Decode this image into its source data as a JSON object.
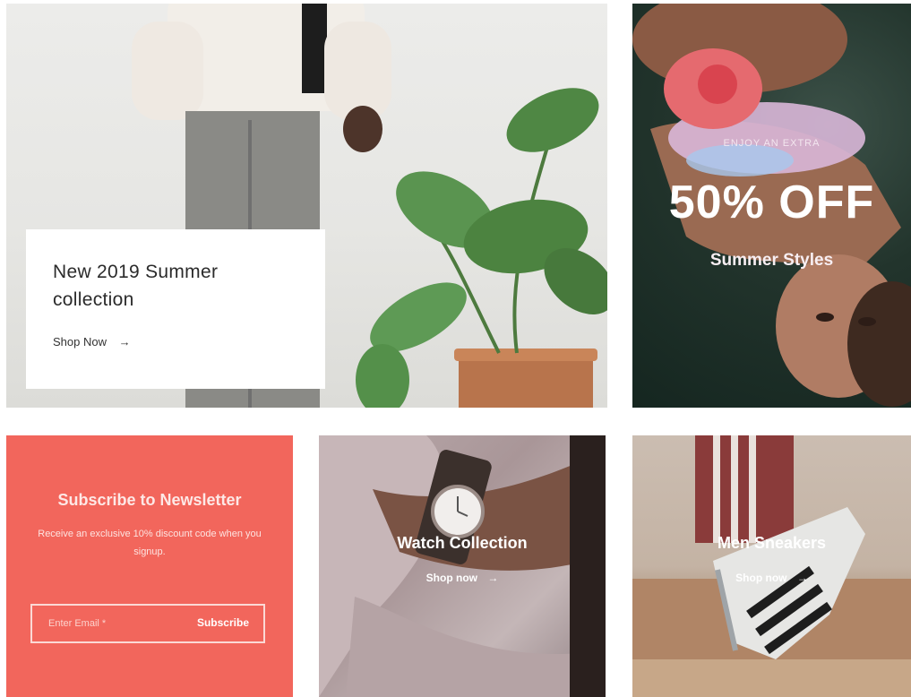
{
  "hero": {
    "title": "New 2019 Summer collection",
    "link_label": "Shop Now",
    "link_arrow": "→"
  },
  "sale": {
    "kicker": "ENJOY AN EXTRA",
    "headline": "50% OFF",
    "subtitle": "Summer Styles"
  },
  "newsletter": {
    "title": "Subscribe to Newsletter",
    "description": "Receive an exclusive 10% discount code when you signup.",
    "email_placeholder": "Enter Email *",
    "button_label": "Subscribe",
    "background_color": "#f2665c"
  },
  "watch": {
    "title": "Watch Collection",
    "link_label": "Shop now",
    "link_arrow": "→"
  },
  "sneakers": {
    "title": "Men Sneakers",
    "link_label": "Shop now",
    "link_arrow": "→"
  }
}
